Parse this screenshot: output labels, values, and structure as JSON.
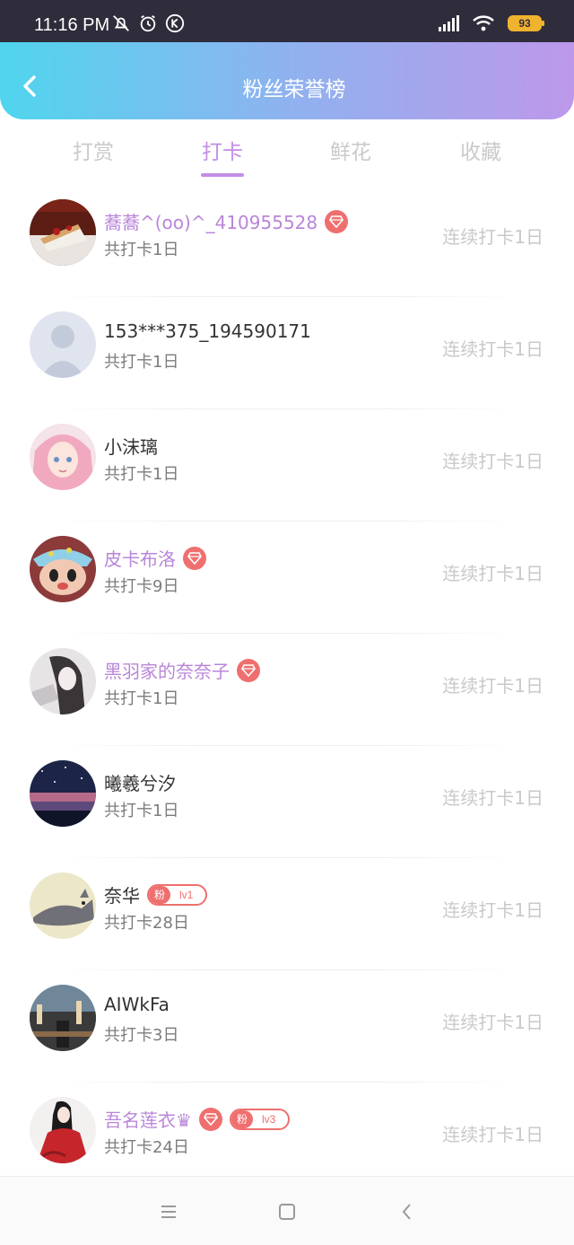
{
  "status_bar": {
    "time": "11:16 PM",
    "battery": "93"
  },
  "header": {
    "title": "粉丝荣誉榜"
  },
  "tabs": [
    {
      "label": "打赏"
    },
    {
      "label": "打卡"
    },
    {
      "label": "鲜花"
    },
    {
      "label": "收藏"
    }
  ],
  "active_tab": "打卡",
  "fans": [
    {
      "name": "蕎蕎^(oo)^_410955528",
      "vip": true,
      "gem": true,
      "fan_badge": null,
      "total": "共打卡1日",
      "streak": "连续打卡1日",
      "avatar": "cake-avatar"
    },
    {
      "name": "153***375_194590171",
      "vip": false,
      "gem": false,
      "fan_badge": null,
      "total": "共打卡1日",
      "streak": "连续打卡1日",
      "avatar": "default-avatar"
    },
    {
      "name": "小沫璃",
      "vip": false,
      "gem": false,
      "fan_badge": null,
      "total": "共打卡1日",
      "streak": "连续打卡1日",
      "avatar": "anime-girl-pink-avatar"
    },
    {
      "name": "皮卡布洛",
      "vip": true,
      "gem": true,
      "fan_badge": null,
      "total": "共打卡9日",
      "streak": "连续打卡1日",
      "avatar": "cartoon-avatar"
    },
    {
      "name": "黑羽家的奈奈子",
      "vip": true,
      "gem": true,
      "fan_badge": null,
      "total": "共打卡1日",
      "streak": "连续打卡1日",
      "avatar": "sketch-girl-avatar"
    },
    {
      "name": "曦羲兮汐",
      "vip": false,
      "gem": false,
      "fan_badge": null,
      "total": "共打卡1日",
      "streak": "连续打卡1日",
      "avatar": "night-sky-avatar"
    },
    {
      "name": "奈华",
      "vip": false,
      "gem": false,
      "fan_badge": {
        "left": "粉",
        "right": "lv1"
      },
      "total": "共打卡28日",
      "streak": "连续打卡1日",
      "avatar": "cat-avatar"
    },
    {
      "name": "AIWkFa",
      "vip": false,
      "gem": false,
      "fan_badge": null,
      "total": "共打卡3日",
      "streak": "连续打卡1日",
      "avatar": "city-avatar"
    },
    {
      "name": "吾名莲衣♛",
      "vip": true,
      "gem": true,
      "fan_badge": {
        "left": "粉",
        "right": "lv3"
      },
      "total": "共打卡24日",
      "streak": "连续打卡1日",
      "avatar": "red-dress-girl-avatar"
    }
  ],
  "colors": {
    "accent": "#c18ee6",
    "vip_name": "#b985d9",
    "gem": "#ef6f6f",
    "header_start": "#4fd5ee",
    "header_end": "#bd98ea"
  }
}
